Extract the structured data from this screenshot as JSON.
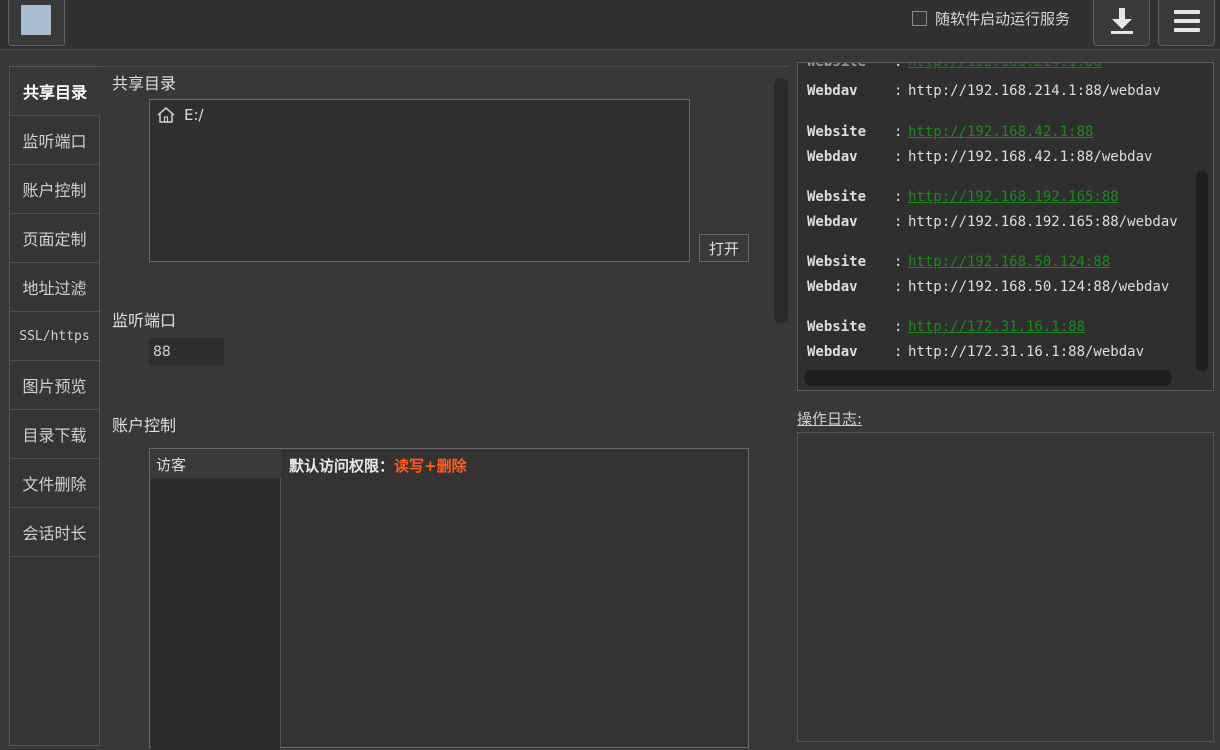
{
  "topbar": {
    "autostart_label": "随软件启动运行服务",
    "autostart_checked": false
  },
  "sidebar": {
    "items": [
      {
        "label": "共享目录",
        "active": true
      },
      {
        "label": "监听端口"
      },
      {
        "label": "账户控制"
      },
      {
        "label": "页面定制"
      },
      {
        "label": "地址过滤"
      },
      {
        "label": "SSL/https"
      },
      {
        "label": "图片预览"
      },
      {
        "label": "目录下载"
      },
      {
        "label": "文件删除"
      },
      {
        "label": "会话时长"
      }
    ]
  },
  "main": {
    "share_dir": {
      "title": "共享目录",
      "entries": [
        "E:/"
      ],
      "open_button": "打开"
    },
    "port": {
      "title": "监听端口",
      "value": "88"
    },
    "account": {
      "title": "账户控制",
      "users": [
        "访客"
      ],
      "default_perm_label": "默认访问权限：",
      "default_perm_value": "读写+删除"
    }
  },
  "addresses": {
    "rows": [
      {
        "key": "Webdav",
        "value": "http://192.168.214.1:88/webdav"
      },
      {
        "key": "Website",
        "value": "http://192.168.42.1:88",
        "link": true
      },
      {
        "key": "Webdav",
        "value": "http://192.168.42.1:88/webdav"
      },
      {
        "key": "Website",
        "value": "http://192.168.192.165:88",
        "link": true
      },
      {
        "key": "Webdav",
        "value": "http://192.168.192.165:88/webdav"
      },
      {
        "key": "Website",
        "value": "http://192.168.50.124:88",
        "link": true
      },
      {
        "key": "Webdav",
        "value": "http://192.168.50.124:88/webdav"
      },
      {
        "key": "Website",
        "value": "http://172.31.16.1:88",
        "link": true
      },
      {
        "key": "Webdav",
        "value": "http://172.31.16.1:88/webdav"
      }
    ],
    "separator": ":"
  },
  "log": {
    "label": "操作日志:"
  },
  "colors": {
    "accent_perm": "#ff5a1f",
    "link": "#1b8a1b",
    "background": "#383838"
  }
}
